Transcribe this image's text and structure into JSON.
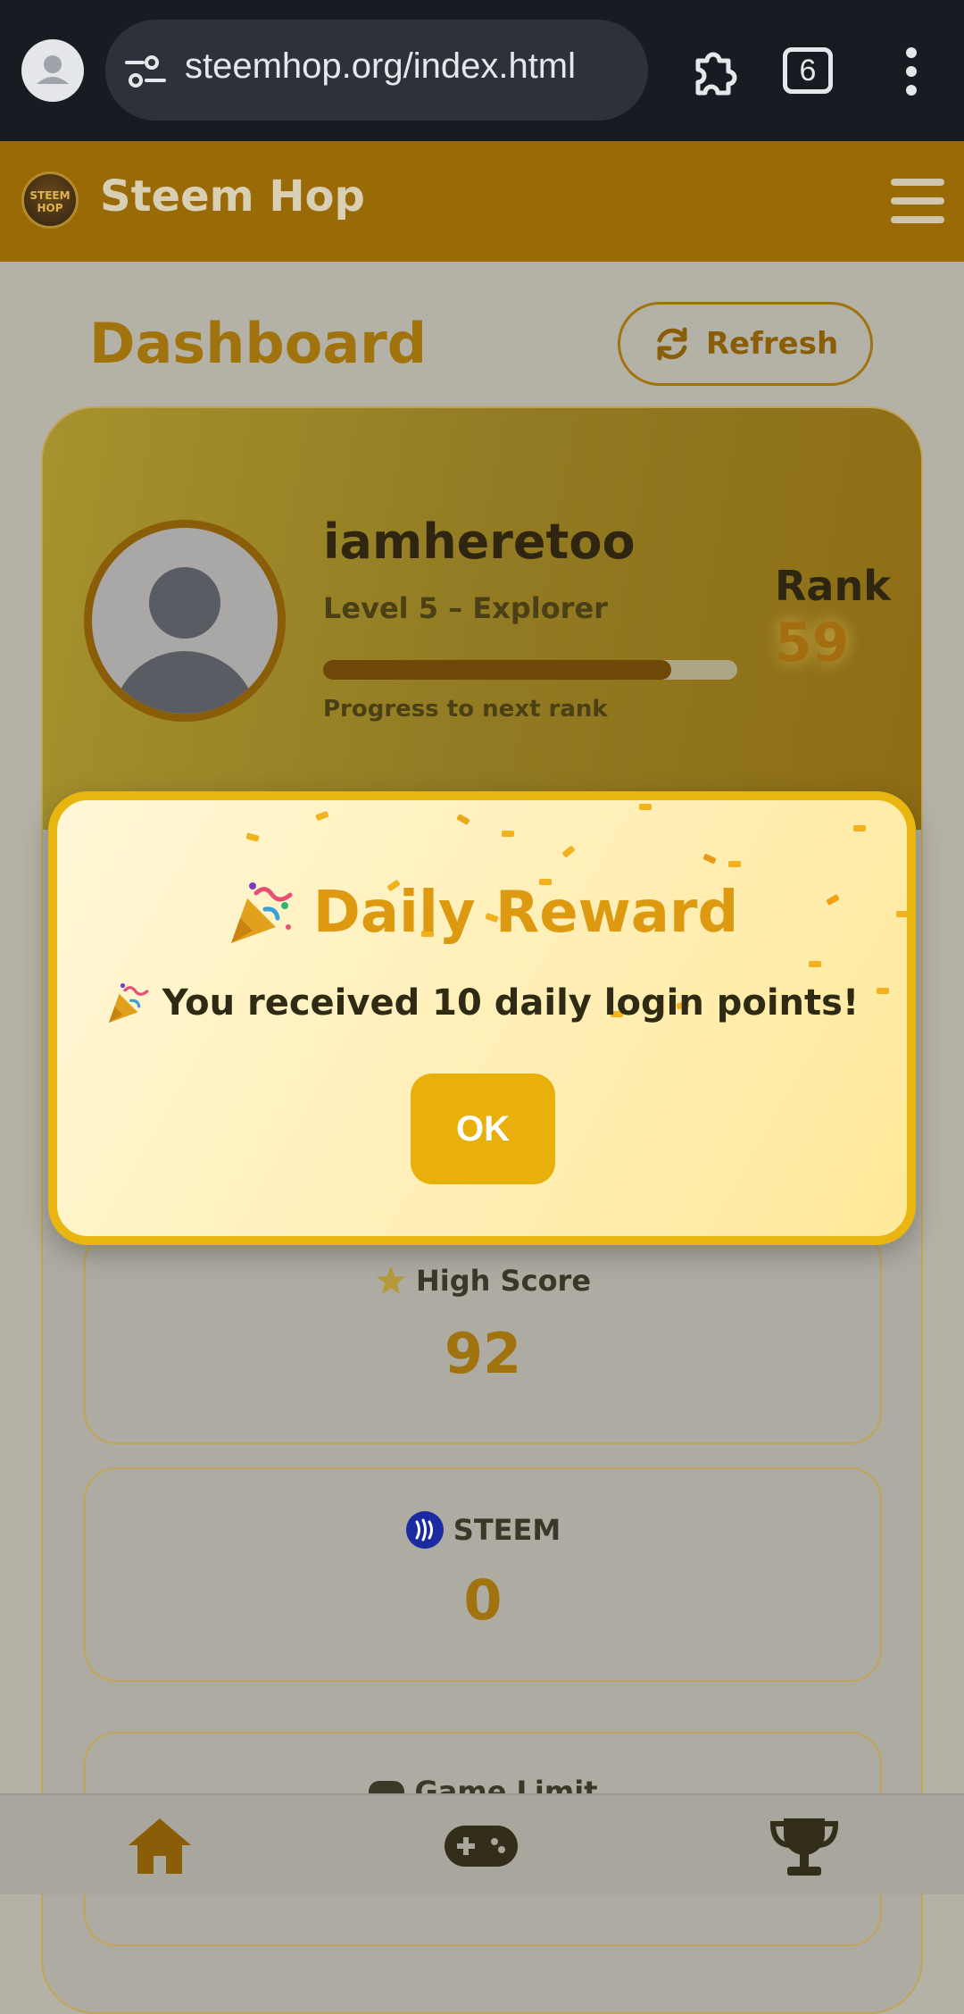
{
  "browser": {
    "url": "steemhop.org/index.html",
    "tab_count": "6"
  },
  "app": {
    "name": "Steem Hop",
    "logo_text_top": "STEEM",
    "logo_text_bottom": "HOP"
  },
  "dashboard": {
    "title": "Dashboard",
    "refresh_label": "Refresh"
  },
  "profile": {
    "username": "iamheretoo",
    "level": "Level 5 – Explorer",
    "progress_fraction": 0.84,
    "progress_label": "Progress to next rank",
    "rank_label": "Rank",
    "rank_value": "59"
  },
  "stats": [
    {
      "label": "High Score",
      "value": "92",
      "icon": "star-icon"
    },
    {
      "label": "STEEM",
      "value": "0",
      "icon": "steem-icon"
    },
    {
      "label": "Game Limit",
      "value": "",
      "icon": "gamepad-icon"
    }
  ],
  "modal": {
    "title": "Daily Reward",
    "message": "You received 10 daily login points!",
    "ok_label": "OK"
  },
  "bottom_nav": [
    "home-icon",
    "gamepad-icon",
    "trophy-icon"
  ],
  "colors": {
    "brand": "#e9b611",
    "accent": "#a0730f",
    "header": "#9a6a07"
  }
}
